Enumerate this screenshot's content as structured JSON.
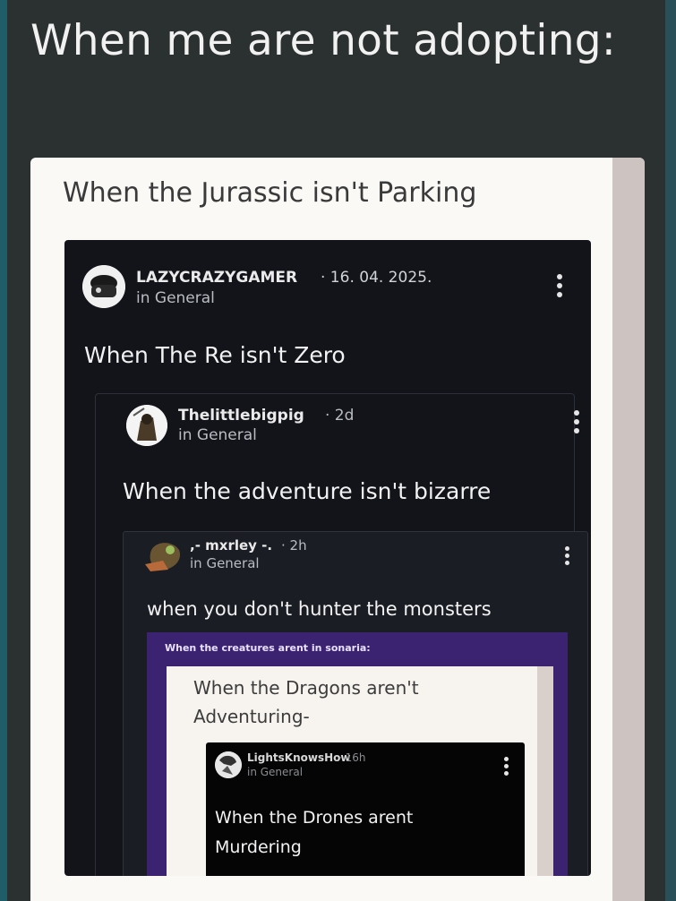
{
  "headline": "When me are not adopting:",
  "outer_card": {
    "title": "When the Jurassic isn't Parking"
  },
  "post1": {
    "username": "LAZYCRAZYGAMER",
    "date": "· 16. 04. 2025.",
    "category": "in General",
    "body": "When The Re isn't Zero",
    "menu_icon": "kebab-menu-icon"
  },
  "post2": {
    "username": "Thelittlebigpig",
    "date": "· 2d",
    "category": "in General",
    "body": "When the adventure isn't bizarre",
    "menu_icon": "kebab-menu-icon"
  },
  "post3": {
    "username": ",- mxrley -.",
    "date": "· 2h",
    "category": "in General",
    "body": "when you don't hunter the monsters",
    "menu_icon": "kebab-menu-icon"
  },
  "embed": {
    "caption": "When the creatures arent in sonaria:",
    "title": "When the Dragons aren't Adventuring-"
  },
  "post4": {
    "username": "LightsKnowsHow",
    "date": "· 16h",
    "category": "in General",
    "body": "When the Drones arent Murdering",
    "menu_icon": "kebab-menu-icon"
  },
  "colors": {
    "background": "#2b3030",
    "card": "#fbf9f6",
    "post_dark": "#12141a",
    "purple_embed": "#3b2371"
  }
}
